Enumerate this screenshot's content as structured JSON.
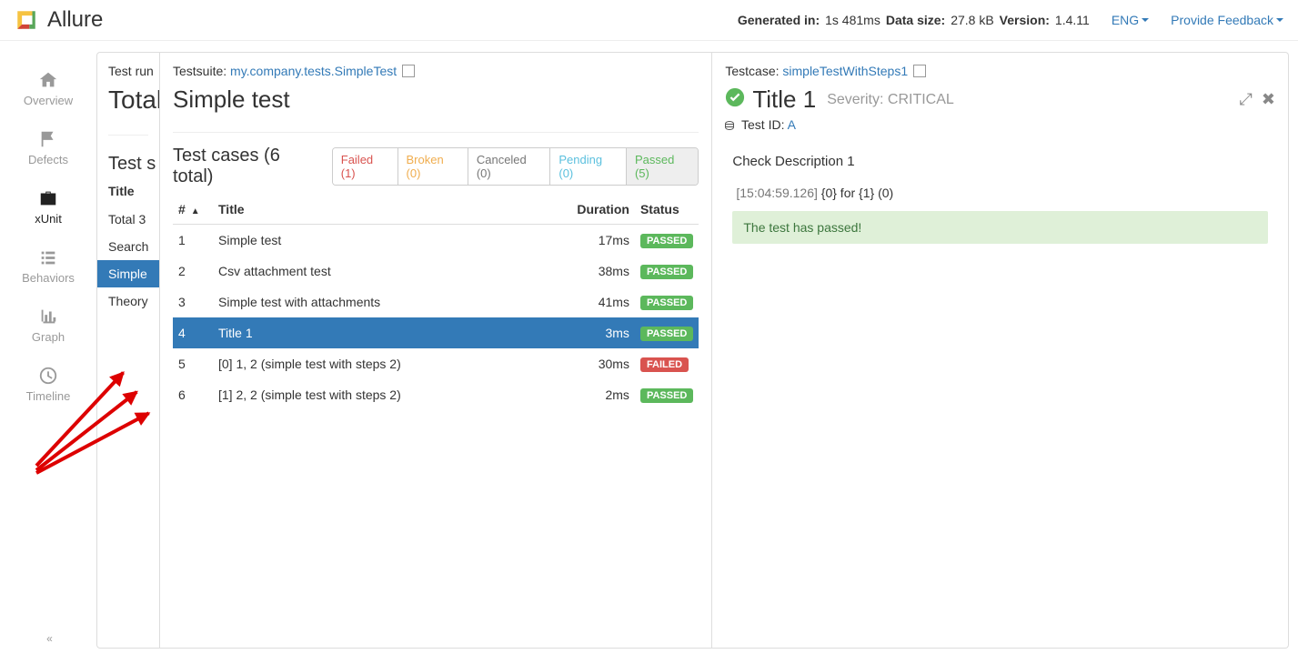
{
  "header": {
    "brand": "Allure",
    "generated_label": "Generated in:",
    "generated_value": "1s 481ms",
    "datasize_label": "Data size:",
    "datasize_value": "27.8 kB",
    "version_label": "Version:",
    "version_value": "1.4.11",
    "lang": "ENG",
    "feedback": "Provide Feedback"
  },
  "sidebar": {
    "items": [
      {
        "label": "Overview"
      },
      {
        "label": "Defects"
      },
      {
        "label": "xUnit"
      },
      {
        "label": "Behaviors"
      },
      {
        "label": "Graph"
      },
      {
        "label": "Timeline"
      }
    ]
  },
  "col1": {
    "breadcrumb": "Test run",
    "title": "Total",
    "section": "Test s",
    "header": "Title",
    "rows": [
      {
        "title": "Total 3"
      },
      {
        "title": "Search"
      },
      {
        "title": "Simple"
      },
      {
        "title": "Theory"
      }
    ]
  },
  "col2": {
    "crumb_label": "Testsuite:",
    "crumb_link": "my.company.tests.SimpleTest",
    "title": "Simple test",
    "tests_title": "Test cases (6 total)",
    "filters": {
      "failed": "Failed (1)",
      "broken": "Broken (0)",
      "canceled": "Canceled (0)",
      "pending": "Pending (0)",
      "passed": "Passed (5)"
    },
    "columns": {
      "num": "#",
      "title": "Title",
      "duration": "Duration",
      "status": "Status"
    },
    "rows": [
      {
        "num": "1",
        "title": "Simple test",
        "duration": "17ms",
        "status": "PASSED",
        "status_class": "passed"
      },
      {
        "num": "2",
        "title": "Csv attachment test",
        "duration": "38ms",
        "status": "PASSED",
        "status_class": "passed"
      },
      {
        "num": "3",
        "title": "Simple test with attachments",
        "duration": "41ms",
        "status": "PASSED",
        "status_class": "passed"
      },
      {
        "num": "4",
        "title": "Title 1",
        "duration": "3ms",
        "status": "PASSED",
        "status_class": "passed",
        "selected": true
      },
      {
        "num": "5",
        "title": "[0] 1, 2 (simple test with steps 2)",
        "duration": "30ms",
        "status": "FAILED",
        "status_class": "failed"
      },
      {
        "num": "6",
        "title": "[1] 2, 2 (simple test with steps 2)",
        "duration": "2ms",
        "status": "PASSED",
        "status_class": "passed"
      }
    ]
  },
  "col3": {
    "crumb_label": "Testcase:",
    "crumb_link": "simpleTestWithSteps1",
    "title": "Title 1",
    "severity_label": "Severity:",
    "severity_value": "CRITICAL",
    "testid_label": "Test ID:",
    "testid_value": "A",
    "description_title": "Check Description 1",
    "step_time": "[15:04:59.126]",
    "step_text": "{0} for {1} (0)",
    "pass_message": "The test has passed!"
  }
}
